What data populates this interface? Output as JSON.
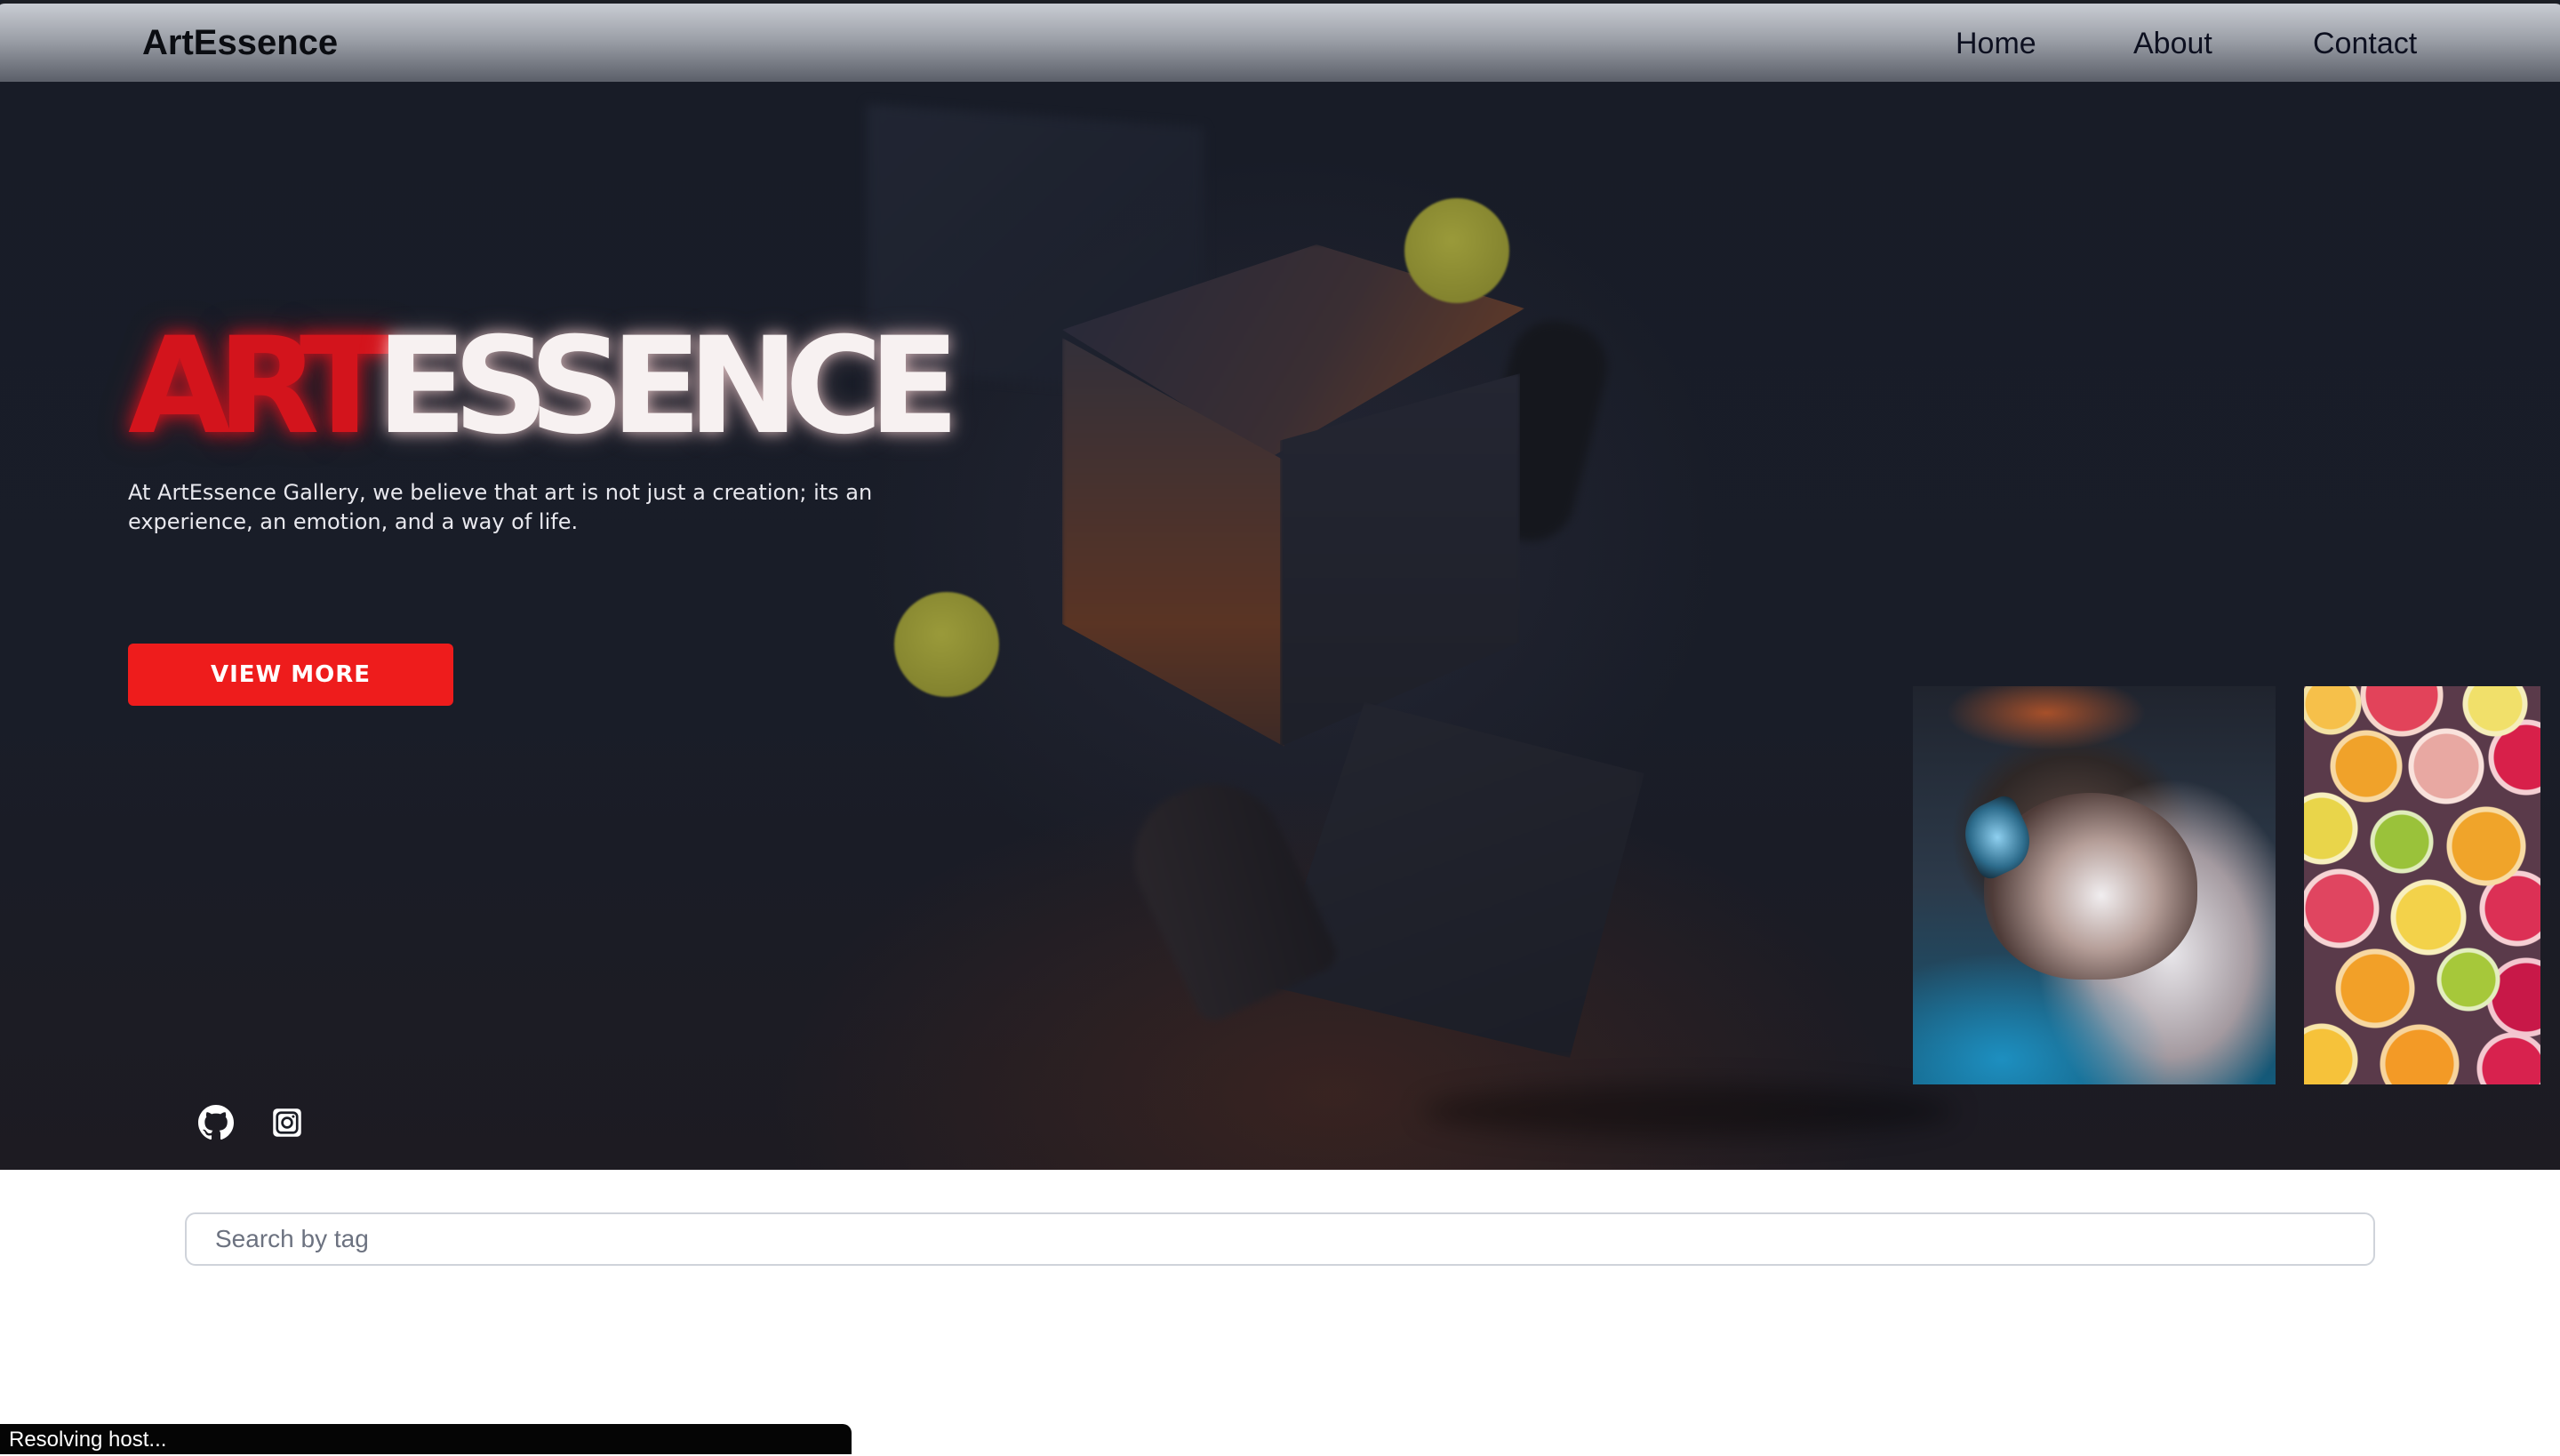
{
  "navbar": {
    "brand": "ArtEssence",
    "links": [
      {
        "label": "Home"
      },
      {
        "label": "About"
      },
      {
        "label": "Contact"
      }
    ]
  },
  "hero": {
    "title_red": "ART",
    "title_white": "ESSENCE",
    "description": "At ArtEssence Gallery, we believe that art is not just a creation; its an experience, an emotion, and a way of life.",
    "button_label": "VIEW MORE",
    "social": [
      {
        "icon": "github-icon"
      },
      {
        "icon": "instagram-icon"
      }
    ]
  },
  "gallery": {
    "thumbnails": [
      {
        "subject": "cat with butterfly"
      },
      {
        "subject": "citrus fruit slices"
      }
    ]
  },
  "search": {
    "placeholder": "Search by tag",
    "value": ""
  },
  "status": {
    "text": "Resolving host..."
  },
  "colors": {
    "accent_red": "#ee1c1c",
    "hero_bg": "#181c27",
    "navbar_gradient_top": "#c9ccd3",
    "navbar_gradient_bottom": "#5b5f69"
  }
}
